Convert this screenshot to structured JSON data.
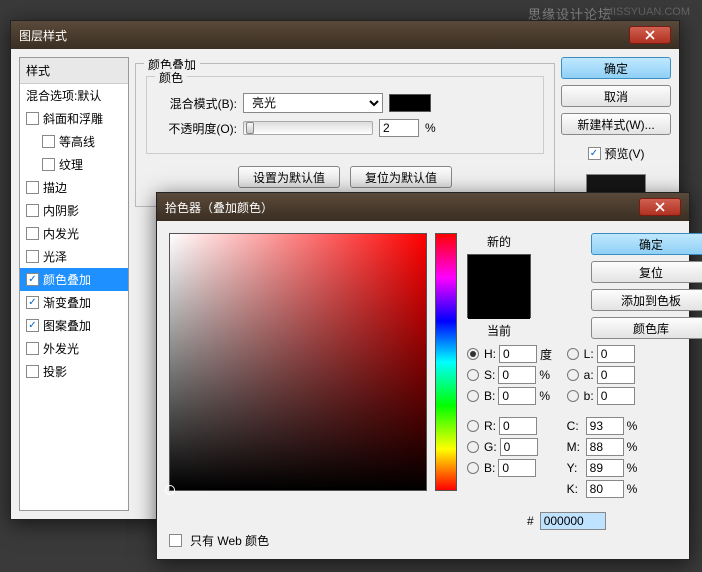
{
  "watermark": "思缘设计论坛",
  "watermark2": "MISSYUAN.COM",
  "layerStyle": {
    "title": "图层样式",
    "stylesHeader": "样式",
    "blendDefault": "混合选项:默认",
    "items": [
      {
        "label": "斜面和浮雕",
        "checked": false,
        "indent": 0
      },
      {
        "label": "等高线",
        "checked": false,
        "indent": 1
      },
      {
        "label": "纹理",
        "checked": false,
        "indent": 1
      },
      {
        "label": "描边",
        "checked": false,
        "indent": 0
      },
      {
        "label": "内阴影",
        "checked": false,
        "indent": 0
      },
      {
        "label": "内发光",
        "checked": false,
        "indent": 0
      },
      {
        "label": "光泽",
        "checked": false,
        "indent": 0
      },
      {
        "label": "颜色叠加",
        "checked": true,
        "indent": 0,
        "selected": true
      },
      {
        "label": "渐变叠加",
        "checked": true,
        "indent": 0
      },
      {
        "label": "图案叠加",
        "checked": true,
        "indent": 0
      },
      {
        "label": "外发光",
        "checked": false,
        "indent": 0
      },
      {
        "label": "投影",
        "checked": false,
        "indent": 0
      }
    ],
    "groupTitle": "颜色叠加",
    "innerTitle": "颜色",
    "blendModeLabel": "混合模式(B):",
    "blendModeValue": "亮光",
    "opacityLabel": "不透明度(O):",
    "opacityValue": "2",
    "opacityUnit": "%",
    "setDefault": "设置为默认值",
    "resetDefault": "复位为默认值",
    "ok": "确定",
    "cancel": "取消",
    "newStyle": "新建样式(W)...",
    "previewLabel": "预览(V)"
  },
  "picker": {
    "title": "拾色器（叠加颜色）",
    "newLabel": "新的",
    "curLabel": "当前",
    "ok": "确定",
    "reset": "复位",
    "addSwatch": "添加到色板",
    "colorLib": "颜色库",
    "H": {
      "label": "H:",
      "value": "0",
      "unit": "度"
    },
    "S": {
      "label": "S:",
      "value": "0",
      "unit": "%"
    },
    "Bv": {
      "label": "B:",
      "value": "0",
      "unit": "%"
    },
    "R": {
      "label": "R:",
      "value": "0",
      "unit": ""
    },
    "G": {
      "label": "G:",
      "value": "0",
      "unit": ""
    },
    "Bc": {
      "label": "B:",
      "value": "0",
      "unit": ""
    },
    "L": {
      "label": "L:",
      "value": "0",
      "unit": ""
    },
    "a": {
      "label": "a:",
      "value": "0",
      "unit": ""
    },
    "b": {
      "label": "b:",
      "value": "0",
      "unit": ""
    },
    "C": {
      "label": "C:",
      "value": "93",
      "unit": "%"
    },
    "M": {
      "label": "M:",
      "value": "88",
      "unit": "%"
    },
    "Y": {
      "label": "Y:",
      "value": "89",
      "unit": "%"
    },
    "K": {
      "label": "K:",
      "value": "80",
      "unit": "%"
    },
    "hexLabel": "#",
    "hexValue": "000000",
    "webOnly": "只有 Web 颜色"
  }
}
